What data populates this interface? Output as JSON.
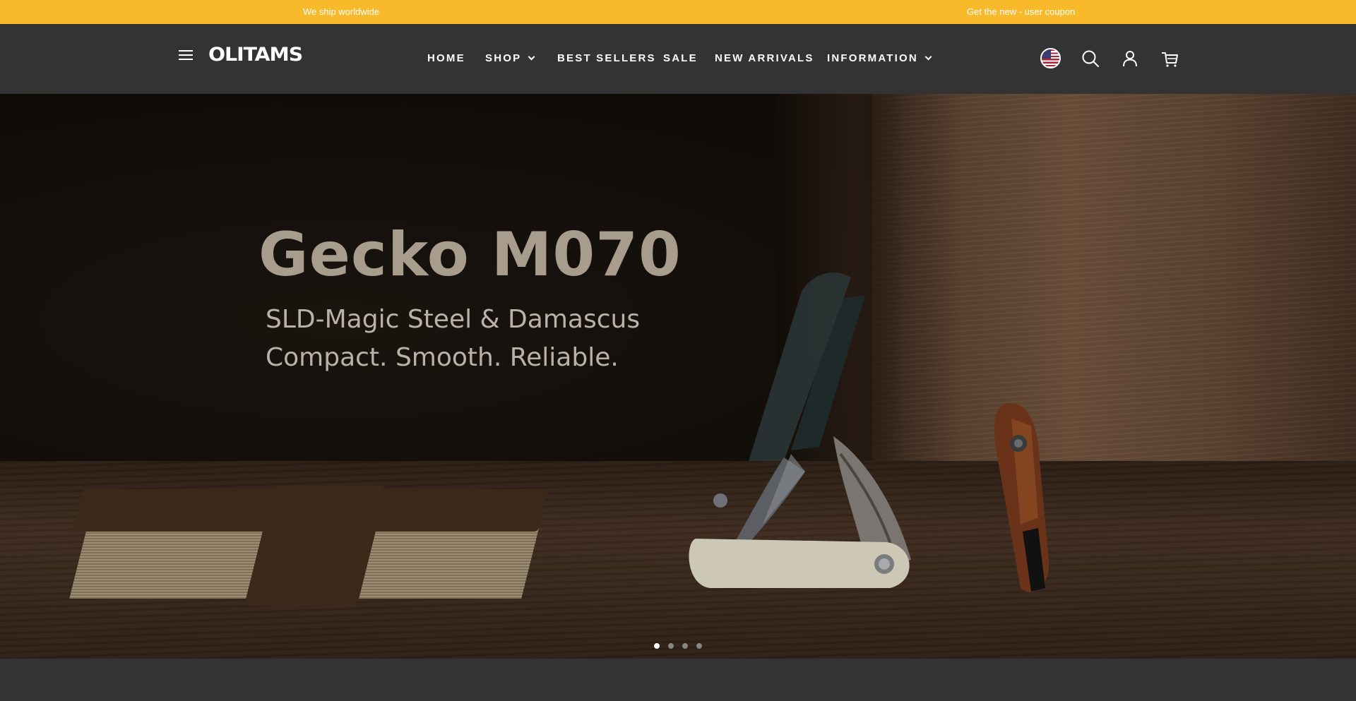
{
  "announcement": {
    "left_text": "We ship worldwide",
    "right_text": "Get the new - user coupon",
    "background": "#f8b92b"
  },
  "header": {
    "menu_icon": "hamburger-icon",
    "logo_text": "OLITAMS",
    "nav": [
      {
        "label": "HOME",
        "has_dropdown": false
      },
      {
        "label": "SHOP",
        "has_dropdown": true
      },
      {
        "label": "BEST SELLERS",
        "has_dropdown": false
      },
      {
        "label": "SALE",
        "has_dropdown": false
      },
      {
        "label": "NEW ARRIVALS",
        "has_dropdown": false
      },
      {
        "label": "INFORMATION",
        "has_dropdown": true
      }
    ],
    "icons": [
      "us-flag-icon",
      "search-icon",
      "account-icon",
      "cart-icon"
    ],
    "background": "#333333"
  },
  "hero": {
    "title": "Gecko M070",
    "line1": "SLD-Magic Steel & Damascus",
    "line2": "Compact.  Smooth.  Reliable.",
    "slides": 4,
    "active_slide": 1
  }
}
